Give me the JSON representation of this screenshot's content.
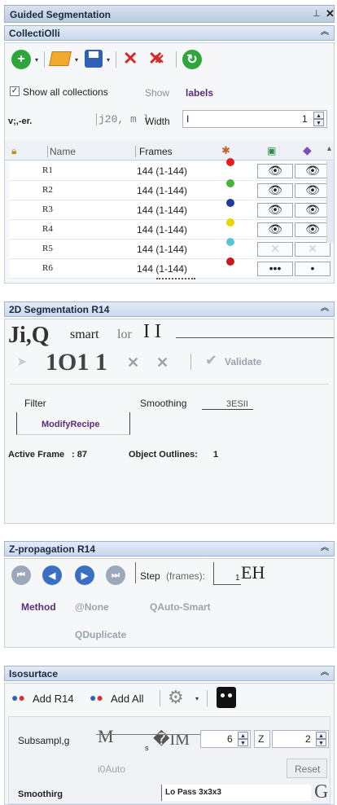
{
  "window": {
    "title": "Guided Segmentation",
    "pin_icon": "pin-icon",
    "close_icon": "close-icon"
  },
  "collections": {
    "header": "CollectiOlli",
    "toolbar": {
      "add": "add-icon",
      "open": "folder-icon",
      "save": "save-icon",
      "delete": "delete-icon",
      "delete_all": "delete-all-icon",
      "refresh": "refresh-icon"
    },
    "show_all_label": "Show all collections",
    "show_label": "Show",
    "labels_label": "labels",
    "field_label": "v;,-er.",
    "field_value": "j20, m l",
    "width_label": "Width",
    "width_prefix": "I",
    "width_value": "1",
    "columns": {
      "name": "Name",
      "frames": "Frames"
    },
    "rows": [
      {
        "name": "R1",
        "frames": "144 (1-144)",
        "color": "#e02020",
        "eyes": true
      },
      {
        "name": "R2",
        "frames": "144 (1-144)",
        "color": "#4ab33a",
        "eyes": true
      },
      {
        "name": "R3",
        "frames": "144 (1-144)",
        "color": "#1f3c9e",
        "eyes": true
      },
      {
        "name": "R4",
        "frames": "144 (1-144)",
        "color": "#e8d400",
        "eyes": true
      },
      {
        "name": "R5",
        "frames": "144 (1-144)",
        "color": "#56c6d6",
        "eyes": false
      },
      {
        "name": "R6",
        "frames": "144 (1-144)",
        "color": "#c21d1d",
        "eyes": false
      }
    ],
    "more_glyph": "•••",
    "bullet_glyph": "•"
  },
  "seg2d": {
    "header": "2D Segmentation R14",
    "glyph_a": "Ji,Q",
    "smart_label": "smart",
    "or_label": "lor",
    "glyph_b": "I I",
    "glyph_c": "1O1 1",
    "validate_label": "Validate",
    "filter_label": "Filter",
    "smoothing_label": "Smoothing",
    "smoothing_value": "3ESII",
    "modify_recipe_label": "ModifyRecipe",
    "active_frame_label": "Active Frame",
    "active_frame_value": ": 87",
    "object_outlines_label": "Object Outlines:",
    "object_outlines_value": "1"
  },
  "zprop": {
    "header": "Z-propagation R14",
    "step_label": "Step",
    "frames_label": "(frames):",
    "step_value": "1",
    "step_suffix": "EH",
    "method_label": "Method",
    "opt_none": "@None",
    "opt_auto_smart": "QAuto-Smart",
    "opt_duplicate": "QDuplicate"
  },
  "isosurface": {
    "header": "Isosurtace",
    "add_label": "Add R14",
    "add_all_label": "Add All",
    "subsampling_label": "Subsampl,g",
    "glyph_m": "M",
    "glyph_s": "s",
    "glyph_im": "�IM",
    "sub_value": "6",
    "z_label": "Z",
    "z_value": "2",
    "auto_label": "i0Auto",
    "reset_label": "Reset",
    "smoothing_label": "Smoothirg",
    "smoothing_value": "Lo Pass  3x3x3",
    "glyph_g": "G"
  }
}
